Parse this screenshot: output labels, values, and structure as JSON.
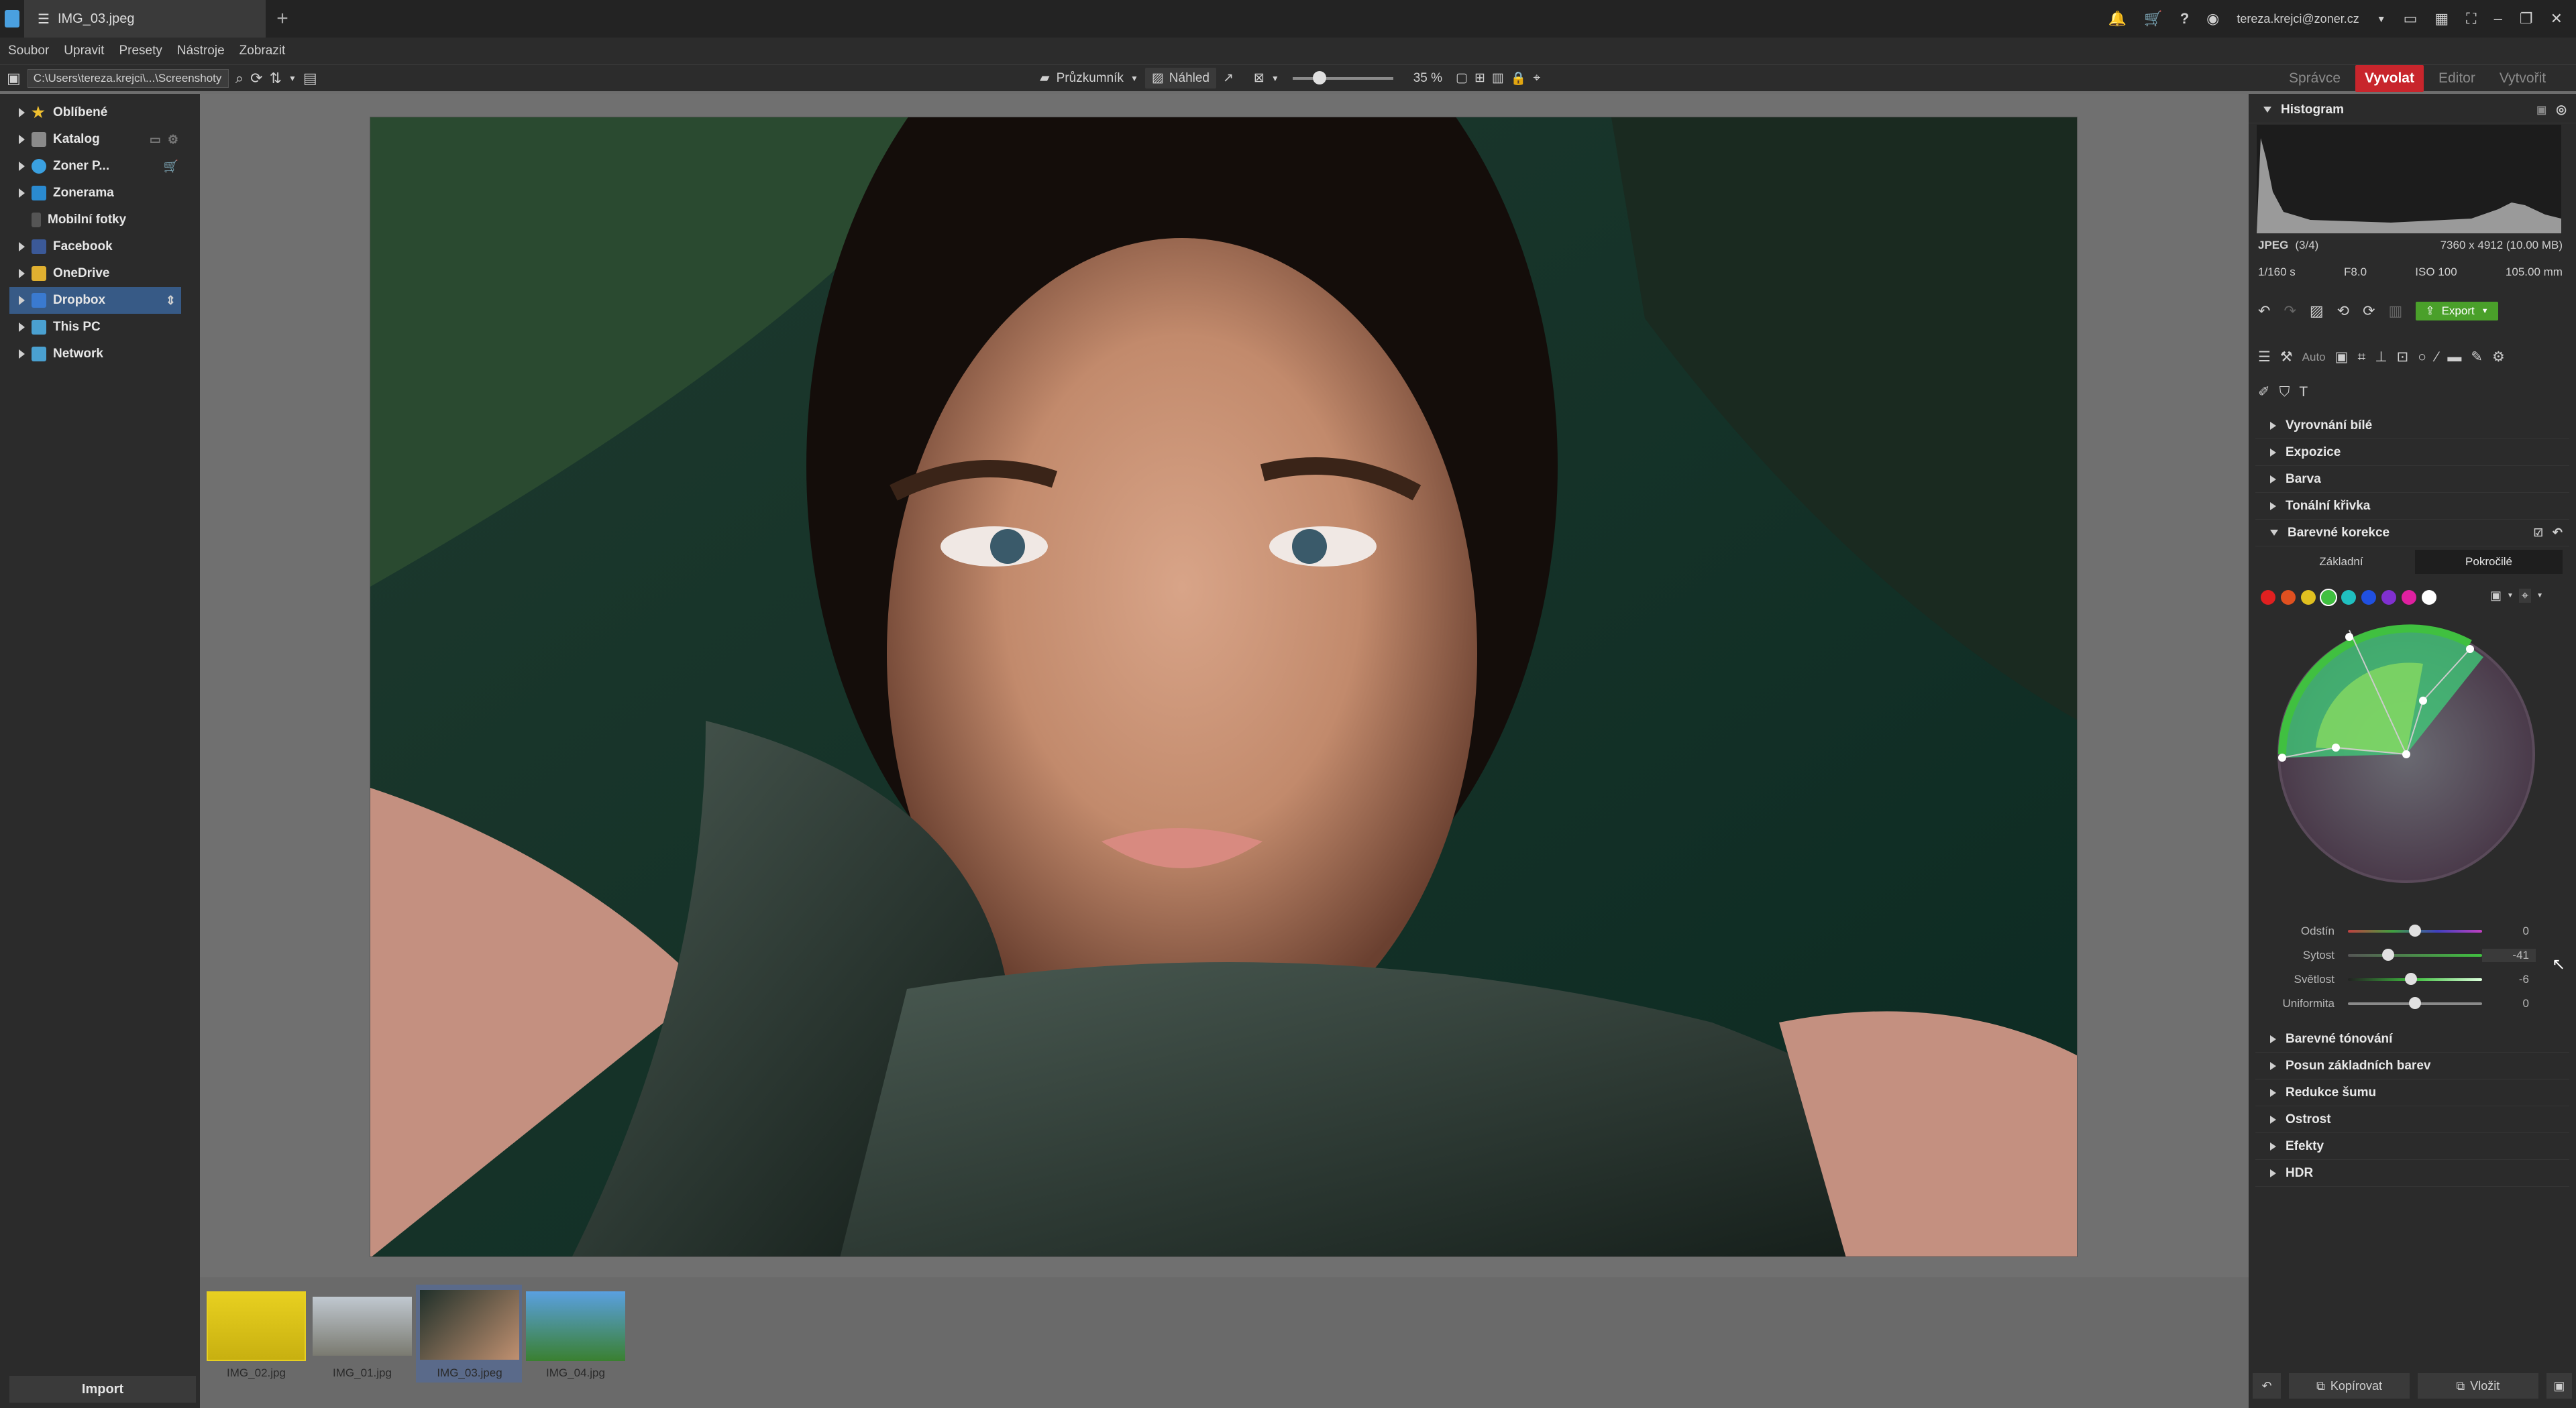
{
  "window": {
    "tab_title": "IMG_03.jpeg",
    "user": "tereza.krejci@zoner.cz"
  },
  "menu": [
    "Soubor",
    "Upravit",
    "Presety",
    "Nástroje",
    "Zobrazit"
  ],
  "toolbar": {
    "path": "C:\\Users\\tereza.krejci\\...\\Screenshoty",
    "explorer_label": "Průzkumník",
    "preview_label": "Náhled",
    "zoom": "35 %",
    "zoom_fraction": 0.35
  },
  "modes": {
    "manager": "Správce",
    "develop": "Vyvolat",
    "editor": "Editor",
    "create": "Vytvořit"
  },
  "navigator": [
    {
      "label": "Oblíbené",
      "icon": "star-icon",
      "color": "#f0c030"
    },
    {
      "label": "Katalog",
      "icon": "catalog-icon",
      "color": "#8a8a8a"
    },
    {
      "label": "Zoner P...",
      "icon": "cloud-icon",
      "color": "#3aa0e0"
    },
    {
      "label": "Zonerama",
      "icon": "zonerama-icon",
      "color": "#2a8ad0"
    },
    {
      "label": "Mobilní fotky",
      "icon": "phone-icon",
      "color": "#555555"
    },
    {
      "label": "Facebook",
      "icon": "facebook-icon",
      "color": "#3b5998"
    },
    {
      "label": "OneDrive",
      "icon": "onedrive-icon",
      "color": "#e0b030"
    },
    {
      "label": "Dropbox",
      "icon": "dropbox-icon",
      "color": "#3a7ad0"
    },
    {
      "label": "This PC",
      "icon": "pc-icon",
      "color": "#4aa0d0"
    },
    {
      "label": "Network",
      "icon": "network-icon",
      "color": "#4aa0d0"
    }
  ],
  "import_label": "Import",
  "filmstrip": [
    {
      "name": "IMG_02.jpg",
      "colors": [
        "#e8d020",
        "#c8b010"
      ]
    },
    {
      "name": "IMG_01.jpg",
      "colors": [
        "#c0c8d0",
        "#7a7a70"
      ]
    },
    {
      "name": "IMG_03.jpeg",
      "colors": [
        "#20302a",
        "#c09070"
      ]
    },
    {
      "name": "IMG_04.jpg",
      "colors": [
        "#5aa0e0",
        "#3a8030"
      ]
    }
  ],
  "histogram": {
    "title": "Histogram",
    "format": "JPEG",
    "index": "(3/4)",
    "dimensions": "7360 x 4912 (10.00 MB)",
    "shutter": "1/160 s",
    "aperture": "F8.0",
    "iso": "ISO 100",
    "focal": "105.00 mm"
  },
  "export_label": "Export",
  "auto_label": "Auto",
  "sections_top": [
    "Vyrovnání bílé",
    "Expozice",
    "Barva",
    "Tonální křivka"
  ],
  "color_correction": {
    "title": "Barevné korekce",
    "tab_basic": "Základní",
    "tab_advanced": "Pokročilé",
    "swatches": [
      "#e02020",
      "#e05020",
      "#e0c020",
      "#40c040",
      "#20c0c0",
      "#2050e0",
      "#8030d0",
      "#e020a0",
      "#ffffff"
    ],
    "sliders": [
      {
        "label": "Odstín",
        "value": "0",
        "position": 0.5
      },
      {
        "label": "Sytost",
        "value": "-41",
        "position": 0.3
      },
      {
        "label": "Světlost",
        "value": "-6",
        "position": 0.47
      },
      {
        "label": "Uniformita",
        "value": "0",
        "position": 0.5
      }
    ]
  },
  "sections_bottom": [
    "Barevné tónování",
    "Posun základních barev",
    "Redukce šumu",
    "Ostrost",
    "Efekty",
    "HDR"
  ],
  "bottom_actions": {
    "copy": "Kopírovat",
    "paste": "Vložit"
  }
}
